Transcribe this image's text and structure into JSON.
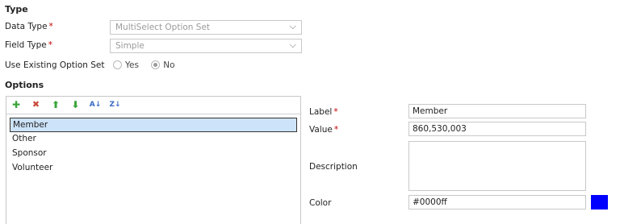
{
  "type_section": {
    "title": "Type",
    "data_type": {
      "label": "Data Type",
      "value": "MultiSelect Option Set"
    },
    "field_type": {
      "label": "Field Type",
      "value": "Simple"
    },
    "use_existing": {
      "label": "Use Existing Option Set",
      "options": [
        {
          "label": "Yes",
          "checked": false
        },
        {
          "label": "No",
          "checked": true
        }
      ]
    }
  },
  "options_section": {
    "title": "Options",
    "toolbar": [
      {
        "icon": "add-icon",
        "glyph": "✚",
        "color": "#3aa53a"
      },
      {
        "icon": "delete-icon",
        "glyph": "✖",
        "color": "#c84a3a"
      },
      {
        "icon": "move-up-icon",
        "glyph": "⬆",
        "color": "#3aa53a"
      },
      {
        "icon": "move-down-icon",
        "glyph": "⬇",
        "color": "#3aa53a"
      },
      {
        "icon": "sort-ascending-icon",
        "glyph": "A↓",
        "color": "#3b6cc4"
      },
      {
        "icon": "sort-descending-icon",
        "glyph": "Z↓",
        "color": "#3b6cc4"
      }
    ],
    "items": [
      "Member",
      "Other",
      "Sponsor",
      "Volunteer"
    ],
    "selected_index": 0
  },
  "details": {
    "label": {
      "label": "Label",
      "value": "Member"
    },
    "value": {
      "label": "Value",
      "value": "860,530,003"
    },
    "description": {
      "label": "Description",
      "value": ""
    },
    "color": {
      "label": "Color",
      "value": "#0000ff",
      "swatch": "#0000ff"
    }
  },
  "colors": {
    "required": "#c00000",
    "selected_bg": "#cde3f9"
  }
}
